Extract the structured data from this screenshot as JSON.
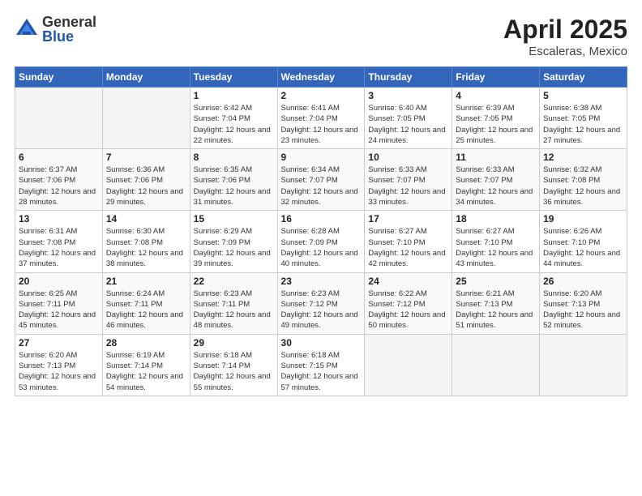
{
  "logo": {
    "general": "General",
    "blue": "Blue"
  },
  "header": {
    "month": "April 2025",
    "location": "Escaleras, Mexico"
  },
  "weekdays": [
    "Sunday",
    "Monday",
    "Tuesday",
    "Wednesday",
    "Thursday",
    "Friday",
    "Saturday"
  ],
  "weeks": [
    [
      {
        "day": "",
        "empty": true
      },
      {
        "day": "",
        "empty": true
      },
      {
        "day": "1",
        "sunrise": "Sunrise: 6:42 AM",
        "sunset": "Sunset: 7:04 PM",
        "daylight": "Daylight: 12 hours and 22 minutes."
      },
      {
        "day": "2",
        "sunrise": "Sunrise: 6:41 AM",
        "sunset": "Sunset: 7:04 PM",
        "daylight": "Daylight: 12 hours and 23 minutes."
      },
      {
        "day": "3",
        "sunrise": "Sunrise: 6:40 AM",
        "sunset": "Sunset: 7:05 PM",
        "daylight": "Daylight: 12 hours and 24 minutes."
      },
      {
        "day": "4",
        "sunrise": "Sunrise: 6:39 AM",
        "sunset": "Sunset: 7:05 PM",
        "daylight": "Daylight: 12 hours and 25 minutes."
      },
      {
        "day": "5",
        "sunrise": "Sunrise: 6:38 AM",
        "sunset": "Sunset: 7:05 PM",
        "daylight": "Daylight: 12 hours and 27 minutes."
      }
    ],
    [
      {
        "day": "6",
        "sunrise": "Sunrise: 6:37 AM",
        "sunset": "Sunset: 7:06 PM",
        "daylight": "Daylight: 12 hours and 28 minutes."
      },
      {
        "day": "7",
        "sunrise": "Sunrise: 6:36 AM",
        "sunset": "Sunset: 7:06 PM",
        "daylight": "Daylight: 12 hours and 29 minutes."
      },
      {
        "day": "8",
        "sunrise": "Sunrise: 6:35 AM",
        "sunset": "Sunset: 7:06 PM",
        "daylight": "Daylight: 12 hours and 31 minutes."
      },
      {
        "day": "9",
        "sunrise": "Sunrise: 6:34 AM",
        "sunset": "Sunset: 7:07 PM",
        "daylight": "Daylight: 12 hours and 32 minutes."
      },
      {
        "day": "10",
        "sunrise": "Sunrise: 6:33 AM",
        "sunset": "Sunset: 7:07 PM",
        "daylight": "Daylight: 12 hours and 33 minutes."
      },
      {
        "day": "11",
        "sunrise": "Sunrise: 6:33 AM",
        "sunset": "Sunset: 7:07 PM",
        "daylight": "Daylight: 12 hours and 34 minutes."
      },
      {
        "day": "12",
        "sunrise": "Sunrise: 6:32 AM",
        "sunset": "Sunset: 7:08 PM",
        "daylight": "Daylight: 12 hours and 36 minutes."
      }
    ],
    [
      {
        "day": "13",
        "sunrise": "Sunrise: 6:31 AM",
        "sunset": "Sunset: 7:08 PM",
        "daylight": "Daylight: 12 hours and 37 minutes."
      },
      {
        "day": "14",
        "sunrise": "Sunrise: 6:30 AM",
        "sunset": "Sunset: 7:08 PM",
        "daylight": "Daylight: 12 hours and 38 minutes."
      },
      {
        "day": "15",
        "sunrise": "Sunrise: 6:29 AM",
        "sunset": "Sunset: 7:09 PM",
        "daylight": "Daylight: 12 hours and 39 minutes."
      },
      {
        "day": "16",
        "sunrise": "Sunrise: 6:28 AM",
        "sunset": "Sunset: 7:09 PM",
        "daylight": "Daylight: 12 hours and 40 minutes."
      },
      {
        "day": "17",
        "sunrise": "Sunrise: 6:27 AM",
        "sunset": "Sunset: 7:10 PM",
        "daylight": "Daylight: 12 hours and 42 minutes."
      },
      {
        "day": "18",
        "sunrise": "Sunrise: 6:27 AM",
        "sunset": "Sunset: 7:10 PM",
        "daylight": "Daylight: 12 hours and 43 minutes."
      },
      {
        "day": "19",
        "sunrise": "Sunrise: 6:26 AM",
        "sunset": "Sunset: 7:10 PM",
        "daylight": "Daylight: 12 hours and 44 minutes."
      }
    ],
    [
      {
        "day": "20",
        "sunrise": "Sunrise: 6:25 AM",
        "sunset": "Sunset: 7:11 PM",
        "daylight": "Daylight: 12 hours and 45 minutes."
      },
      {
        "day": "21",
        "sunrise": "Sunrise: 6:24 AM",
        "sunset": "Sunset: 7:11 PM",
        "daylight": "Daylight: 12 hours and 46 minutes."
      },
      {
        "day": "22",
        "sunrise": "Sunrise: 6:23 AM",
        "sunset": "Sunset: 7:11 PM",
        "daylight": "Daylight: 12 hours and 48 minutes."
      },
      {
        "day": "23",
        "sunrise": "Sunrise: 6:23 AM",
        "sunset": "Sunset: 7:12 PM",
        "daylight": "Daylight: 12 hours and 49 minutes."
      },
      {
        "day": "24",
        "sunrise": "Sunrise: 6:22 AM",
        "sunset": "Sunset: 7:12 PM",
        "daylight": "Daylight: 12 hours and 50 minutes."
      },
      {
        "day": "25",
        "sunrise": "Sunrise: 6:21 AM",
        "sunset": "Sunset: 7:13 PM",
        "daylight": "Daylight: 12 hours and 51 minutes."
      },
      {
        "day": "26",
        "sunrise": "Sunrise: 6:20 AM",
        "sunset": "Sunset: 7:13 PM",
        "daylight": "Daylight: 12 hours and 52 minutes."
      }
    ],
    [
      {
        "day": "27",
        "sunrise": "Sunrise: 6:20 AM",
        "sunset": "Sunset: 7:13 PM",
        "daylight": "Daylight: 12 hours and 53 minutes."
      },
      {
        "day": "28",
        "sunrise": "Sunrise: 6:19 AM",
        "sunset": "Sunset: 7:14 PM",
        "daylight": "Daylight: 12 hours and 54 minutes."
      },
      {
        "day": "29",
        "sunrise": "Sunrise: 6:18 AM",
        "sunset": "Sunset: 7:14 PM",
        "daylight": "Daylight: 12 hours and 55 minutes."
      },
      {
        "day": "30",
        "sunrise": "Sunrise: 6:18 AM",
        "sunset": "Sunset: 7:15 PM",
        "daylight": "Daylight: 12 hours and 57 minutes."
      },
      {
        "day": "",
        "empty": true
      },
      {
        "day": "",
        "empty": true
      },
      {
        "day": "",
        "empty": true
      }
    ]
  ]
}
